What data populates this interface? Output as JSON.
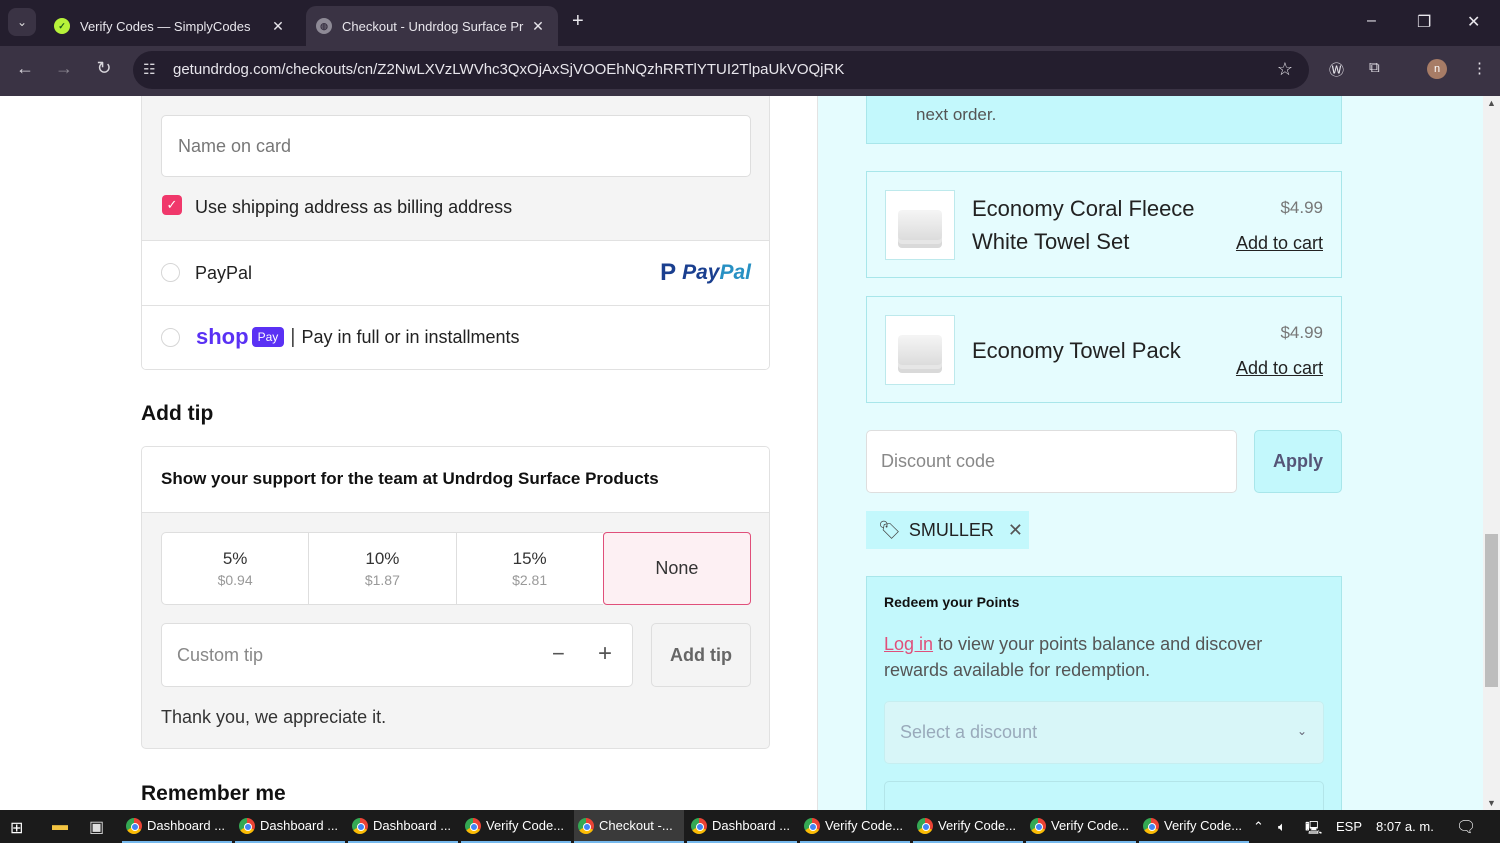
{
  "browser": {
    "tabs": [
      {
        "title": "Verify Codes — SimplyCodes",
        "favicon": "simplycodes-icon",
        "active": false
      },
      {
        "title": "Checkout - Undrdog Surface Pr",
        "favicon": "globe-icon",
        "active": true
      }
    ],
    "new_tab_symbol": "+",
    "url": "getundrdog.com/checkouts/cn/Z2NwLXVzLWVhc3QxOjAxSjVOOEhNQzhRRTlYTUI2TlpaUkVOQjRK",
    "profile_initial": "n",
    "window_controls": {
      "minimize": "–",
      "restore": "❐",
      "close": "✕"
    }
  },
  "payment": {
    "name_on_card_placeholder": "Name on card",
    "billing_checkbox_label": "Use shipping address as billing address",
    "billing_checkbox_checked": true,
    "methods": [
      {
        "label": "PayPal",
        "logo_text_1": "Pay",
        "logo_text_2": "Pal"
      },
      {
        "shop_word": "shop",
        "shop_pay_badge": "Pay",
        "separator": "|",
        "label": "Pay in full or in installments"
      }
    ]
  },
  "tip": {
    "heading": "Add tip",
    "support_text": "Show your support for the team at Undrdog Surface Products",
    "options": [
      {
        "percent": "5%",
        "amount": "$0.94"
      },
      {
        "percent": "10%",
        "amount": "$1.87"
      },
      {
        "percent": "15%",
        "amount": "$2.81"
      },
      {
        "percent": "None",
        "amount": ""
      }
    ],
    "selected": "None",
    "custom_placeholder": "Custom tip",
    "decrement": "−",
    "increment": "+",
    "add_button": "Add tip",
    "thanks": "Thank you, we appreciate it."
  },
  "remember_heading": "Remember me",
  "sidebar": {
    "notice_tail": "next order.",
    "upsells": [
      {
        "name_line1": "Economy Coral Fleece",
        "name_line2": "White Towel Set",
        "price": "$4.99",
        "action": "Add to cart"
      },
      {
        "name_line1": "Economy Towel Pack",
        "name_line2": "",
        "price": "$4.99",
        "action": "Add to cart"
      }
    ],
    "discount_placeholder": "Discount code",
    "apply_button": "Apply",
    "applied_code": "SMULLER",
    "points": {
      "title": "Redeem your Points",
      "login_link": "Log in",
      "description": " to view your points balance and discover rewards available for redemption.",
      "select_placeholder": "Select a discount"
    }
  },
  "colors": {
    "accent_pink": "#f0386b",
    "sidebar_bg": "#e5fcfe",
    "sidebar_box": "#c3f8fc",
    "shop_purple": "#5a31f4",
    "paypal_blue": "#1a3f8f"
  },
  "taskbar": {
    "apps": [
      {
        "label": "Dashboard ...",
        "active": false
      },
      {
        "label": "Dashboard ...",
        "active": false
      },
      {
        "label": "Dashboard ...",
        "active": false
      },
      {
        "label": "Verify Code...",
        "active": false
      },
      {
        "label": "Checkout -...",
        "active": true
      },
      {
        "label": "Dashboard ...",
        "active": false
      },
      {
        "label": "Verify Code...",
        "active": false
      },
      {
        "label": "Verify Code...",
        "active": false
      },
      {
        "label": "Verify Code...",
        "active": false
      },
      {
        "label": "Verify Code...",
        "active": false
      }
    ],
    "language": "ESP",
    "time": "8:07 a. m."
  }
}
